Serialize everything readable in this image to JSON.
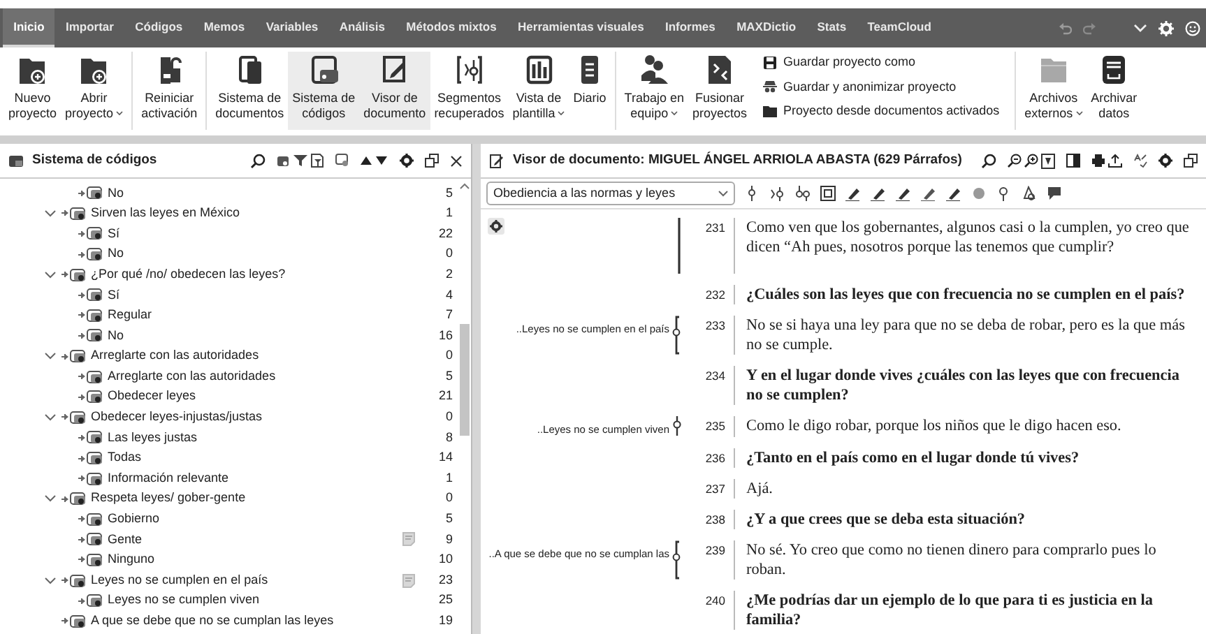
{
  "menu": {
    "tabs": [
      {
        "label": "Inicio",
        "selected": true
      },
      {
        "label": "Importar",
        "selected": false
      },
      {
        "label": "Códigos",
        "selected": false
      },
      {
        "label": "Memos",
        "selected": false
      },
      {
        "label": "Variables",
        "selected": false
      },
      {
        "label": "Análisis",
        "selected": false
      },
      {
        "label": "Métodos mixtos",
        "selected": false
      },
      {
        "label": "Herramientas visuales",
        "selected": false
      },
      {
        "label": "Informes",
        "selected": false
      },
      {
        "label": "MAXDictio",
        "selected": false
      },
      {
        "label": "Stats",
        "selected": false
      },
      {
        "label": "TeamCloud",
        "selected": false
      }
    ]
  },
  "ribbon": {
    "groups": [
      {
        "items": [
          {
            "kind": "large",
            "lines": [
              "Nuevo",
              "proyecto"
            ],
            "dropdown": false,
            "selected": false
          },
          {
            "kind": "large",
            "lines": [
              "Abrir",
              "proyecto"
            ],
            "dropdown": true,
            "selected": false
          }
        ]
      },
      {
        "items": [
          {
            "kind": "large",
            "lines": [
              "Reiniciar",
              "activación"
            ],
            "dropdown": false,
            "selected": false
          }
        ]
      },
      {
        "items": [
          {
            "kind": "large",
            "lines": [
              "Sistema de",
              "documentos"
            ],
            "dropdown": false,
            "selected": false
          },
          {
            "kind": "large",
            "lines": [
              "Sistema de",
              "códigos"
            ],
            "dropdown": false,
            "selected": true
          },
          {
            "kind": "large",
            "lines": [
              "Visor de",
              "documento"
            ],
            "dropdown": false,
            "selected": true
          },
          {
            "kind": "large",
            "lines": [
              "Segmentos",
              "recuperados"
            ],
            "dropdown": false,
            "selected": false
          },
          {
            "kind": "large",
            "lines": [
              "Vista de",
              "plantilla"
            ],
            "dropdown": true,
            "selected": false
          },
          {
            "kind": "large",
            "lines": [
              "Diario"
            ],
            "dropdown": false,
            "selected": false
          }
        ]
      },
      {
        "items": [
          {
            "kind": "large",
            "lines": [
              "Trabajo en",
              "equipo"
            ],
            "dropdown": true,
            "selected": false
          },
          {
            "kind": "large",
            "lines": [
              "Fusionar",
              "proyectos"
            ],
            "dropdown": false,
            "selected": false
          },
          {
            "kind": "small",
            "label": "Guardar proyecto como"
          },
          {
            "kind": "small",
            "label": "Guardar y anonimizar proyecto"
          },
          {
            "kind": "small",
            "label": "Proyecto desde documentos activados"
          }
        ]
      },
      {
        "items": [
          {
            "kind": "large",
            "lines": [
              "Archivos",
              "externos"
            ],
            "dropdown": true,
            "selected": false
          },
          {
            "kind": "large",
            "lines": [
              "Archivar",
              "datos"
            ],
            "dropdown": false,
            "selected": false
          }
        ]
      }
    ]
  },
  "code_system": {
    "title": "Sistema de códigos",
    "codes": [
      {
        "children": [
          {
            "label": "No",
            "count": "5",
            "memo": false
          }
        ]
      },
      {
        "label": "Sirven las leyes en México",
        "count": "1",
        "expanded": true,
        "memo": false,
        "children": [
          {
            "label": "Sí",
            "count": "22",
            "memo": false
          },
          {
            "label": "No",
            "count": "0",
            "memo": false
          }
        ]
      },
      {
        "label": "¿Por qué /no/ obedecen las leyes?",
        "count": "2",
        "expanded": true,
        "memo": false,
        "children": [
          {
            "label": "Sí",
            "count": "4",
            "memo": false
          },
          {
            "label": "Regular",
            "count": "7",
            "memo": false
          },
          {
            "label": "No",
            "count": "16",
            "memo": false
          }
        ]
      },
      {
        "label": "Arreglarte con las autoridades",
        "count": "0",
        "expanded": true,
        "memo": false,
        "children": [
          {
            "label": "Arreglarte con las autoridades",
            "count": "5",
            "memo": false
          },
          {
            "label": "Obedecer leyes",
            "count": "21",
            "memo": false
          }
        ]
      },
      {
        "label": "Obedecer leyes-injustas/justas",
        "count": "0",
        "expanded": true,
        "memo": false,
        "children": [
          {
            "label": "Las leyes justas",
            "count": "8",
            "memo": false
          },
          {
            "label": "Todas",
            "count": "14",
            "memo": false
          },
          {
            "label": "Información relevante",
            "count": "1",
            "memo": false
          }
        ]
      },
      {
        "label": "Respeta leyes/ gober-gente",
        "count": "0",
        "expanded": true,
        "memo": false,
        "children": [
          {
            "label": "Gobierno",
            "count": "5",
            "memo": false
          },
          {
            "label": "Gente",
            "count": "9",
            "memo": true
          },
          {
            "label": "Ninguno",
            "count": "10",
            "memo": false
          }
        ]
      },
      {
        "label": "Leyes no se cumplen en el país",
        "count": "23",
        "expanded": true,
        "memo": true,
        "children": [
          {
            "label": "Leyes no se cumplen viven",
            "count": "25",
            "memo": false
          }
        ]
      },
      {
        "label": "A que se debe que no se cumplan las leyes",
        "count": "19",
        "memo": false
      }
    ]
  },
  "document_viewer": {
    "title": "Visor de documento: MIGUEL ÁNGEL ARRIOLA ABASTA (629 Párrafos)",
    "code_selector": {
      "value": "Obediencia a las normas y leyes"
    },
    "paragraphs": [
      {
        "number": "231",
        "text": "Como ven que los gobernantes, algunos casi o la cumplen, yo creo que dicen “Ah pues, nosotros porque las tenemos que cumplir?",
        "bold": false,
        "segment": {
          "kind": "line"
        }
      },
      {
        "number": "232",
        "text": "¿Cuáles son las leyes que con frecuencia no se cumplen en el país?",
        "bold": true
      },
      {
        "number": "233",
        "text": "No se si haya una ley para que no se deba de robar, pero es la que más no se cumple.",
        "bold": false,
        "segment": {
          "kind": "brace",
          "label": "..Leyes no se cumplen en el país"
        }
      },
      {
        "number": "234",
        "text": "Y en el lugar donde vives ¿cuáles con las leyes que con frecuencia no se cumplen?",
        "bold": true
      },
      {
        "number": "235",
        "text": "Como le digo robar, porque los niños que le digo hacen eso.",
        "bold": false,
        "segment": {
          "kind": "pin",
          "label": "..Leyes no se cumplen viven"
        }
      },
      {
        "number": "236",
        "text": "¿Tanto en el país como en el lugar donde tú vives?",
        "bold": true
      },
      {
        "number": "237",
        "text": "Ajá.",
        "bold": false
      },
      {
        "number": "238",
        "text": "¿Y a que crees que se deba esta situación?",
        "bold": true
      },
      {
        "number": "239",
        "text": "No sé. Yo creo que como no tienen dinero para comprarlo pues lo roban.",
        "bold": false,
        "segment": {
          "kind": "brace",
          "label": "..A que se debe que no se cumplan las"
        }
      },
      {
        "number": "240",
        "text": "¿Me podrías dar un ejemplo de lo que para ti es justicia en la familia?",
        "bold": true
      }
    ]
  }
}
